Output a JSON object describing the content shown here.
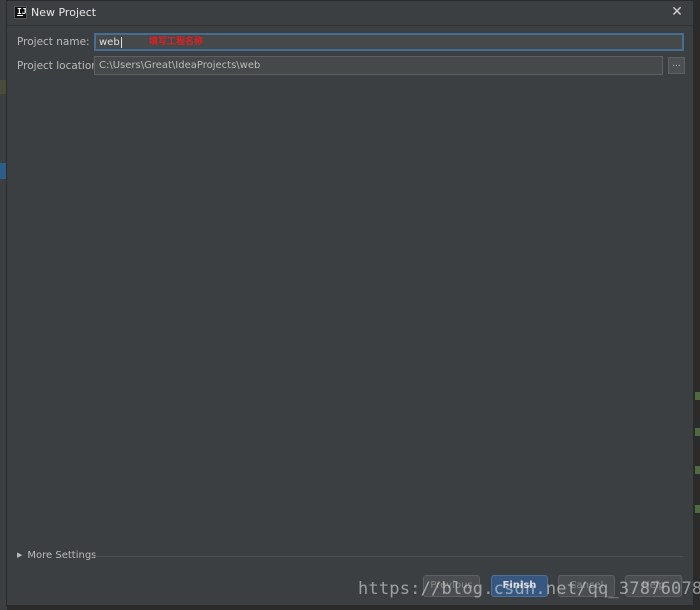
{
  "dialog": {
    "title": "New Project",
    "app_icon_letters": "IJ",
    "close_symbol": "✕"
  },
  "form": {
    "project_name_label": "Project name:",
    "project_name_value": "web",
    "project_name_annotation": "填写工程名称",
    "project_location_label": "Project location:",
    "project_location_value": "C:\\Users\\Great\\IdeaProjects\\web",
    "browse_label": "..."
  },
  "more_settings": {
    "label": "More Settings",
    "expanded": false,
    "arrow_icon": "triangle-right-icon"
  },
  "buttons": {
    "previous": "Previous",
    "finish": "Finish",
    "cancel": "Cancel",
    "help": "Help"
  },
  "watermark": "https://blog.csdn.net/qq_37876078",
  "colors": {
    "dialog_bg": "#3c3f41",
    "field_bg": "#45494a",
    "focus_border": "#466d94",
    "primary_button": "#365880",
    "annotation": "#e02020"
  }
}
